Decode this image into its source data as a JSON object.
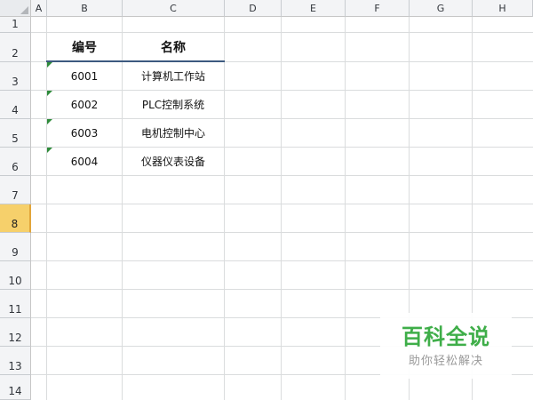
{
  "sheet": {
    "columns": [
      "A",
      "B",
      "C",
      "D",
      "E",
      "F",
      "G",
      "H"
    ],
    "rows": [
      "1",
      "2",
      "3",
      "4",
      "5",
      "6",
      "7",
      "8",
      "9",
      "10",
      "11",
      "12",
      "13",
      "14"
    ],
    "selected_row": "8",
    "table": {
      "headers": {
        "b": "编号",
        "c": "名称"
      },
      "records": [
        {
          "b": "6001",
          "c": "计算机工作站"
        },
        {
          "b": "6002",
          "c": "PLC控制系统"
        },
        {
          "b": "6003",
          "c": "电机控制中心"
        },
        {
          "b": "6004",
          "c": "仪器仪表设备"
        }
      ]
    }
  },
  "watermark": {
    "title": "百科全说",
    "subtitle": "助你轻松解决"
  },
  "colors": {
    "selected_row_header": "#f6d06b",
    "error_flag": "#2e8b3a",
    "watermark_green": "#3fae49"
  }
}
